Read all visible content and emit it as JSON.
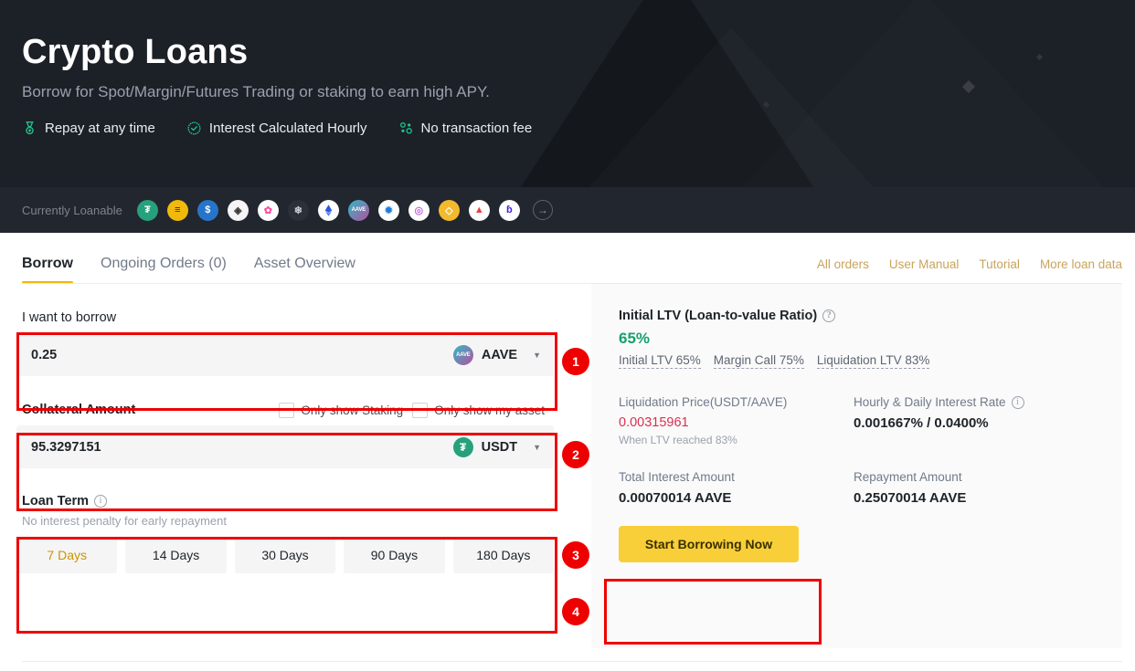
{
  "hero": {
    "title": "Crypto Loans",
    "subtitle": "Borrow for Spot/Margin/Futures Trading or staking to earn high APY.",
    "features": [
      {
        "icon": "medal-icon",
        "label": "Repay at any time"
      },
      {
        "icon": "check-badge-icon",
        "label": "Interest Calculated Hourly"
      },
      {
        "icon": "no-fee-icon",
        "label": "No transaction fee"
      }
    ]
  },
  "loanable": {
    "label": "Currently Loanable",
    "coins": [
      {
        "symbol": "USDT",
        "glyph": "₮",
        "class": "c-usdt"
      },
      {
        "symbol": "BUSD",
        "glyph": "≡",
        "class": "c-busd"
      },
      {
        "symbol": "USDC",
        "glyph": "$",
        "class": "c-usdc"
      },
      {
        "symbol": "DAI",
        "glyph": "◈",
        "class": "c-dai"
      },
      {
        "symbol": "SUSHI",
        "glyph": "✿",
        "class": "c-sushi"
      },
      {
        "symbol": "FRAX",
        "glyph": "❄",
        "class": "c-frax"
      },
      {
        "symbol": "ETH",
        "glyph": "◆",
        "class": "c-eth"
      },
      {
        "symbol": "AAVE",
        "glyph": "AAVE",
        "class": "c-aave"
      },
      {
        "symbol": "NEAR",
        "glyph": "✹",
        "class": "c-near"
      },
      {
        "symbol": "MKR",
        "glyph": "◎",
        "class": "c-mkr"
      },
      {
        "symbol": "BNB",
        "glyph": "◇",
        "class": "c-bnb"
      },
      {
        "symbol": "AVAX",
        "glyph": "▲",
        "class": "c-ava"
      },
      {
        "symbol": "BAND",
        "glyph": "ɓ",
        "class": "c-band"
      }
    ],
    "more_icon": "arrow-right-circle-icon"
  },
  "tabs": [
    {
      "label": "Borrow",
      "active": true
    },
    {
      "label": "Ongoing Orders (0)",
      "active": false
    },
    {
      "label": "Asset Overview",
      "active": false
    }
  ],
  "toplinks": [
    "All orders",
    "User Manual",
    "Tutorial",
    "More loan data"
  ],
  "form": {
    "borrow": {
      "label": "I want to borrow",
      "value": "0.25",
      "asset": "AAVE",
      "caret_icon": "chevron-down-icon"
    },
    "collateral": {
      "label": "Collateral Amount",
      "value": "95.3297151",
      "asset": "USDT",
      "caret_icon": "chevron-down-icon",
      "checkboxes": [
        {
          "label": "Only show Staking",
          "checked": false
        },
        {
          "label": "Only show my asset",
          "checked": false
        }
      ]
    },
    "loan_term": {
      "label": "Loan Term",
      "info_icon": "info-icon",
      "helper": "No interest penalty for early repayment",
      "options": [
        {
          "label": "7 Days",
          "active": true
        },
        {
          "label": "14 Days",
          "active": false
        },
        {
          "label": "30 Days",
          "active": false
        },
        {
          "label": "90 Days",
          "active": false
        },
        {
          "label": "180 Days",
          "active": false
        }
      ]
    }
  },
  "annotations": [
    {
      "number": "1"
    },
    {
      "number": "2"
    },
    {
      "number": "3"
    },
    {
      "number": "4"
    }
  ],
  "summary": {
    "ltv_title": "Initial LTV (Loan-to-value Ratio)",
    "ltv_help_icon": "question-circle-icon",
    "ltv_value": "65%",
    "ltv_chips": [
      "Initial LTV 65%",
      "Margin Call 75%",
      "Liquidation LTV 83%"
    ],
    "liquidation_price_label": "Liquidation Price(USDT/AAVE)",
    "liquidation_price_value": "0.00315961",
    "liquidation_price_note": "When LTV reached 83%",
    "interest_rate_label": "Hourly & Daily Interest Rate",
    "interest_rate_info_icon": "info-icon",
    "interest_rate_value": "0.001667% / 0.0400%",
    "total_interest_label": "Total Interest Amount",
    "total_interest_value": "0.00070014 AAVE",
    "repayment_label": "Repayment Amount",
    "repayment_value": "0.25070014 AAVE",
    "cta_label": "Start Borrowing Now"
  },
  "colors": {
    "hero_bg": "#1c2027",
    "strip_bg": "#22262e",
    "accent_yellow": "#f0b90b",
    "cta_yellow": "#f8cf38",
    "green": "#16a06d",
    "red_value": "#d9304f",
    "annotation_red": "#ee0000",
    "link_gold": "#c9a45c",
    "panel_bg": "#fafafa"
  }
}
